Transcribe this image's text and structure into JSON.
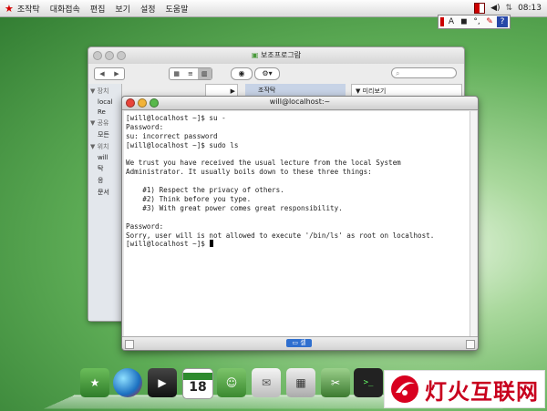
{
  "menubar": {
    "items": [
      "조작탁",
      "대화접속",
      "편집",
      "보기",
      "설정",
      "도움말"
    ],
    "clock": "08:13"
  },
  "ime": {
    "letter": "A"
  },
  "file_browser": {
    "title": "보조프로그람",
    "sidebar": {
      "section_devices": "장치",
      "devices": [
        "local",
        "Re"
      ],
      "section_shared": "공유",
      "shared": [
        "모든"
      ],
      "section_places": "위치",
      "places": [
        "will",
        "탁",
        "응",
        "문서"
      ]
    },
    "column_b_label": "조작탁",
    "column_c_label": "미리보기"
  },
  "terminal": {
    "title": "will@localhost:~",
    "lines": [
      "[will@localhost ~]$ su -",
      "Password:",
      "su: incorrect password",
      "[will@localhost ~]$ sudo ls",
      "",
      "We trust you have received the usual lecture from the local System",
      "Administrator. It usually boils down to these three things:",
      "",
      "    #1) Respect the privacy of others.",
      "    #2) Think before you type.",
      "    #3) With great power comes great responsibility.",
      "",
      "Password:",
      "Sorry, user will is not allowed to execute '/bin/ls' as root on localhost.",
      "[will@localhost ~]$ "
    ],
    "tab_label": "셀"
  },
  "dock": {
    "calendar_day": "18"
  },
  "watermark": {
    "text": "灯火互联网"
  },
  "colors": {
    "accent_red": "#d40000",
    "selection_blue": "#2f6fcf"
  }
}
